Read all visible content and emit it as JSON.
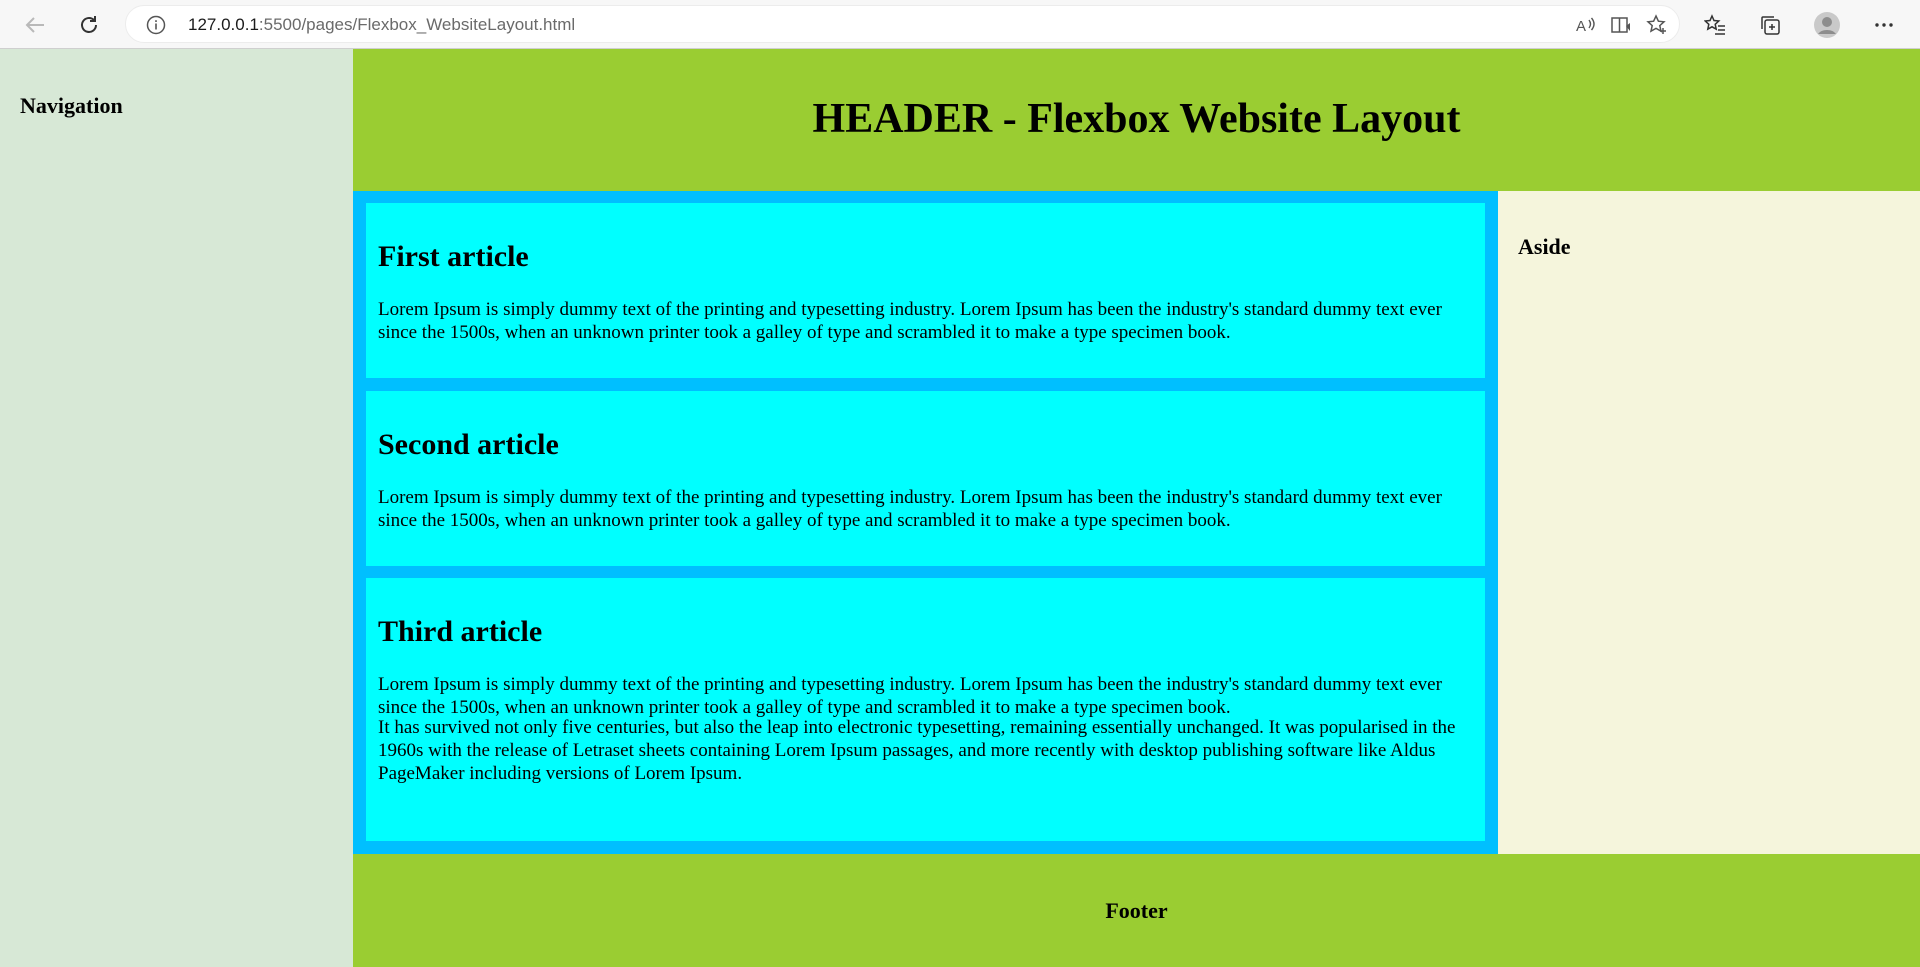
{
  "browser": {
    "url_host": "127.0.0.1",
    "url_rest": ":5500/pages/Flexbox_WebsiteLayout.html"
  },
  "nav": {
    "title": "Navigation"
  },
  "header": {
    "title": "HEADER - Flexbox Website Layout"
  },
  "articles": [
    {
      "title": "First article",
      "paragraphs": [
        "Lorem Ipsum is simply dummy text of the printing and typesetting industry. Lorem Ipsum has been the industry's standard dummy text ever since the 1500s, when an unknown printer took a galley of type and scrambled it to make a type specimen book."
      ]
    },
    {
      "title": "Second article",
      "paragraphs": [
        "Lorem Ipsum is simply dummy text of the printing and typesetting industry. Lorem Ipsum has been the industry's standard dummy text ever since the 1500s, when an unknown printer took a galley of type and scrambled it to make a type specimen book."
      ]
    },
    {
      "title": "Third article",
      "paragraphs": [
        "Lorem Ipsum is simply dummy text of the printing and typesetting industry. Lorem Ipsum has been the industry's standard dummy text ever since the 1500s, when an unknown printer took a galley of type and scrambled it to make a type specimen book.",
        "It has survived not only five centuries, but also the leap into electronic typesetting, remaining essentially unchanged. It was popularised in the 1960s with the release of Letraset sheets containing Lorem Ipsum passages, and more recently with desktop publishing software like Aldus PageMaker including versions of Lorem Ipsum."
      ]
    }
  ],
  "aside": {
    "title": "Aside"
  },
  "footer": {
    "title": "Footer"
  },
  "colors": {
    "nav_bg": "#d7e8d6",
    "header_bg": "#9acd32",
    "main_bg": "#00bfff",
    "article_bg": "#00ffff",
    "aside_bg": "#f5f5dc",
    "footer_bg": "#9acd32"
  },
  "icons": [
    "back-arrow-icon",
    "refresh-icon",
    "info-icon",
    "read-aloud-icon",
    "immersive-reader-icon",
    "add-favorite-icon",
    "favorites-icon",
    "collections-icon",
    "profile-avatar-icon",
    "more-menu-icon"
  ]
}
